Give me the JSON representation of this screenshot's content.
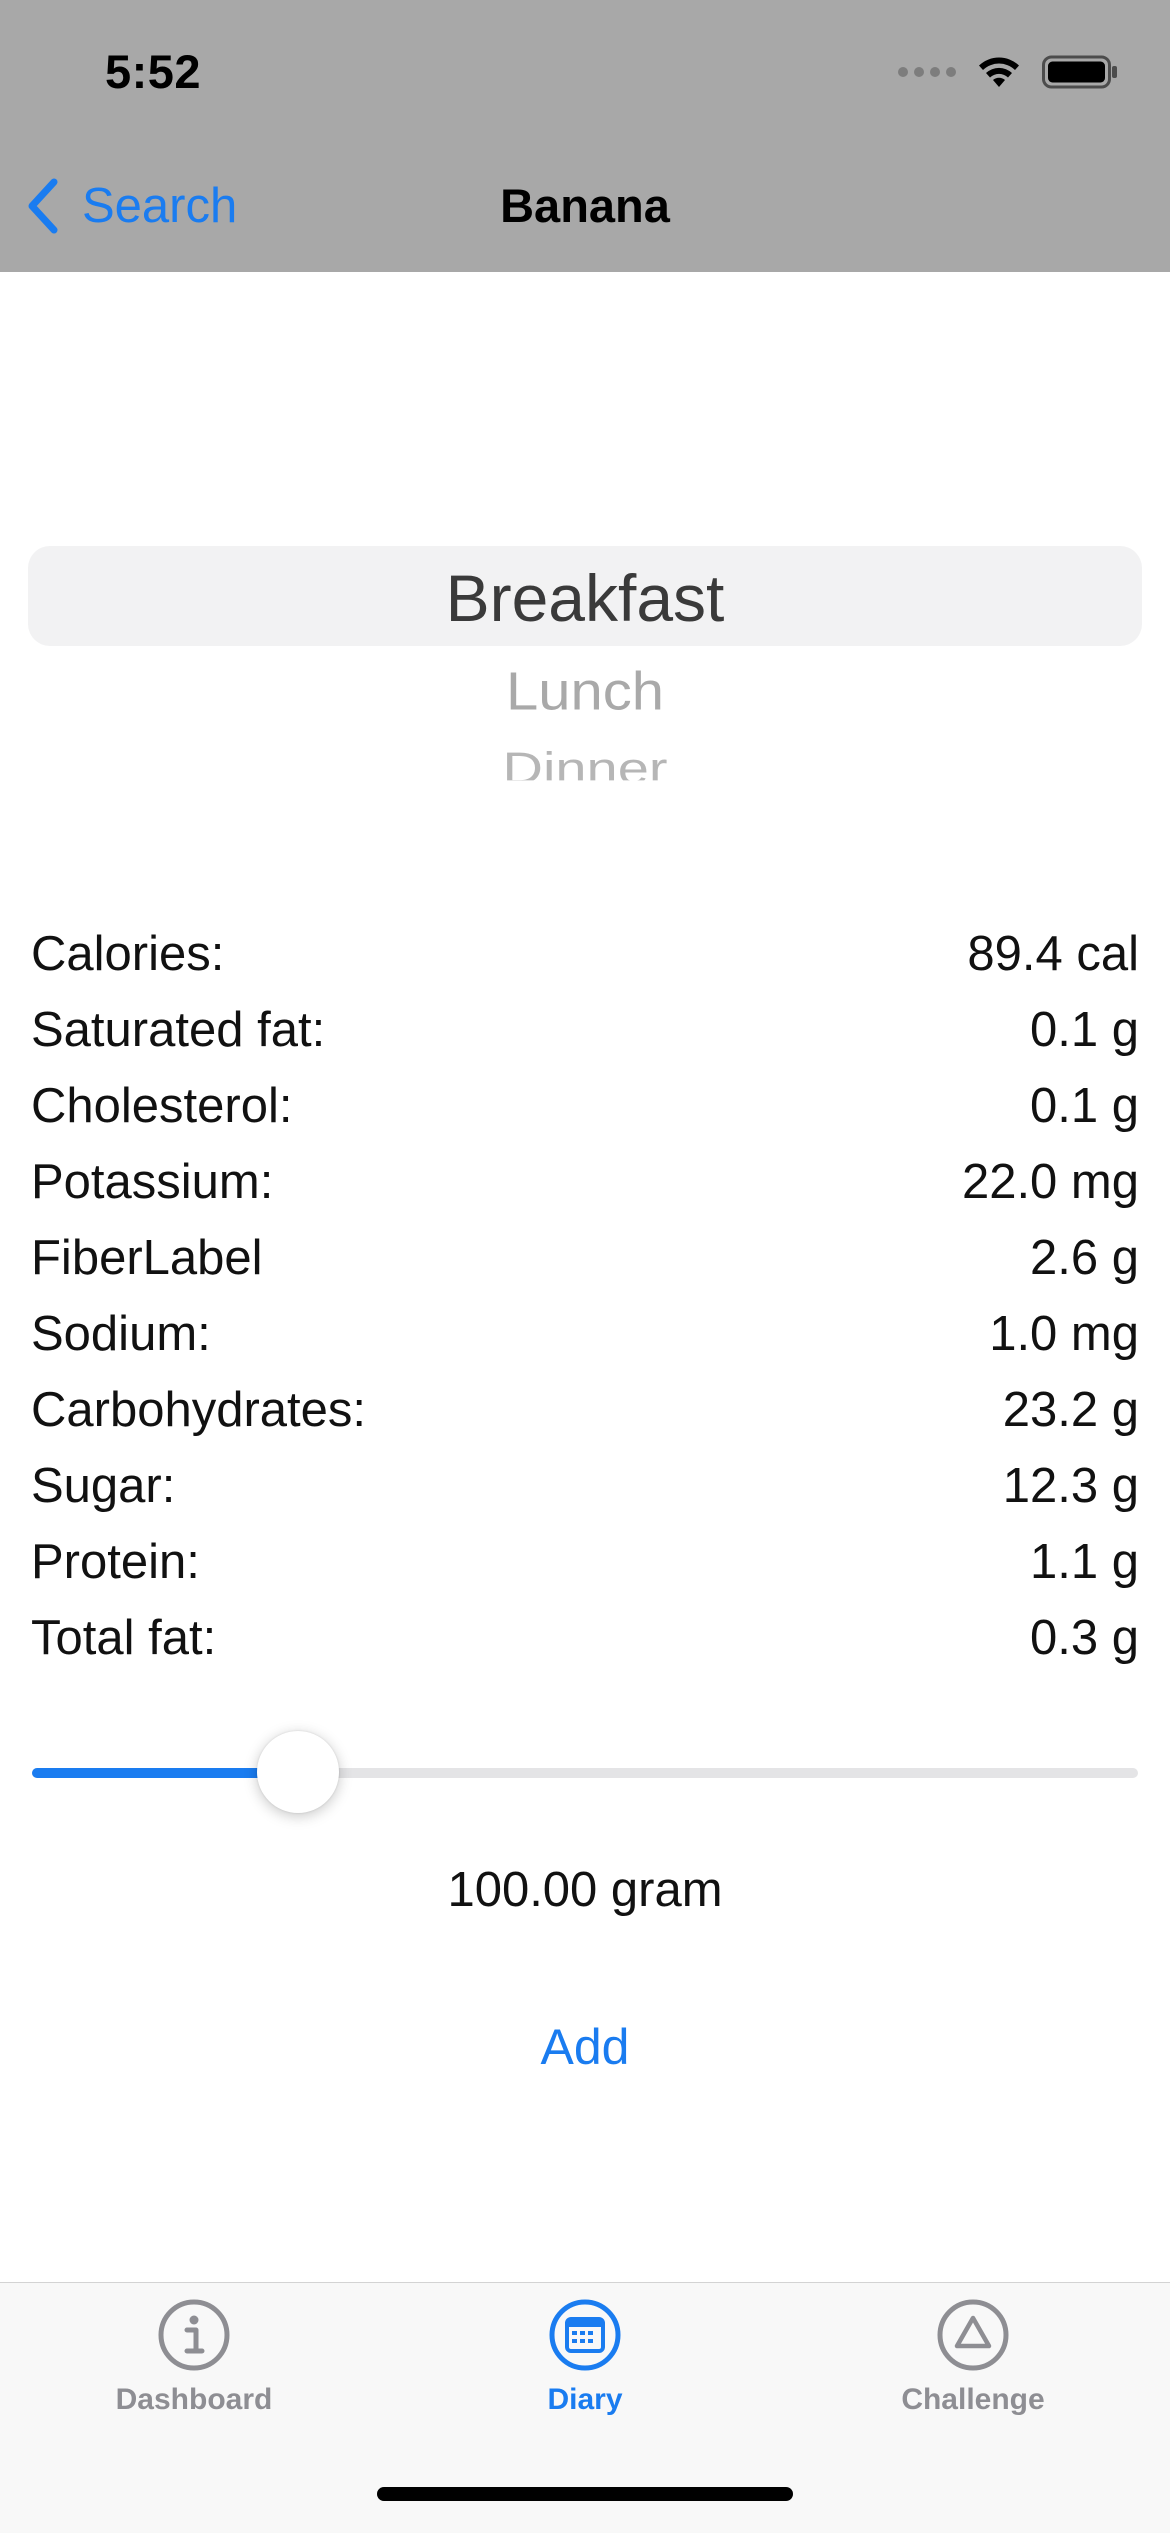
{
  "status_bar": {
    "time": "5:52"
  },
  "nav": {
    "back_label": "Search",
    "title": "Banana"
  },
  "meal_picker": {
    "options": [
      "Breakfast",
      "Lunch",
      "Dinner"
    ],
    "selected": "Breakfast"
  },
  "nutrition": [
    {
      "label": "Calories:",
      "value": "89.4 cal"
    },
    {
      "label": "Saturated fat:",
      "value": "0.1 g"
    },
    {
      "label": "Cholesterol:",
      "value": "0.1 g"
    },
    {
      "label": "Potassium:",
      "value": "22.0 mg"
    },
    {
      "label": "FiberLabel",
      "value": "2.6 g"
    },
    {
      "label": "Sodium:",
      "value": "1.0 mg"
    },
    {
      "label": "Carbohydrates:",
      "value": "23.2 g"
    },
    {
      "label": "Sugar:",
      "value": "12.3 g"
    },
    {
      "label": "Protein:",
      "value": "1.1 g"
    },
    {
      "label": "Total fat:",
      "value": "0.3 g"
    }
  ],
  "amount_slider": {
    "fraction": 0.22
  },
  "amount_label": "100.00 gram",
  "add_label": "Add",
  "tabs": [
    {
      "label": "Dashboard",
      "icon": "info-circle-icon",
      "active": false
    },
    {
      "label": "Diary",
      "icon": "calendar-icon",
      "active": true
    },
    {
      "label": "Challenge",
      "icon": "triangle-circle-icon",
      "active": false
    }
  ],
  "colors": {
    "accent": "#1a7cf0",
    "header_bg": "#a8a8a8",
    "tab_inactive": "#8e8e93"
  }
}
